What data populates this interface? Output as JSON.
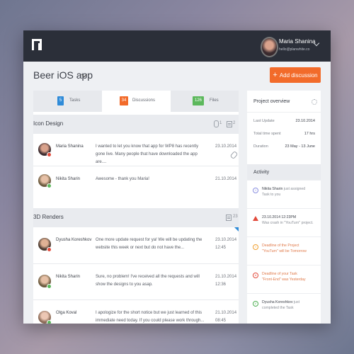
{
  "header": {
    "user_name": "Maria Shanina",
    "user_email": "hello@planwhite.co"
  },
  "project": {
    "title": "Beer iOS app",
    "add_button": "Add discussion",
    "add_icon": "+"
  },
  "tabs": [
    {
      "label": "Tasks",
      "count": "5",
      "color": "#2f8bd8"
    },
    {
      "label": "Discussions",
      "count": "34",
      "color": "#f26b2a"
    },
    {
      "label": "Files",
      "count": "126",
      "color": "#5cb85c"
    }
  ],
  "sections": [
    {
      "title": "Icon Design",
      "attachments": "1",
      "comments": "2",
      "rows": [
        {
          "name": "Maria Shanina",
          "message": "I wanted to let you know that app for WP8 has recently gone live. Many people that have downloaded the app are....",
          "date": "23.10.2014"
        },
        {
          "name": "Nikita Sharin",
          "message": "Awesome - thank you Maria!",
          "date": "21.10.2014"
        }
      ]
    },
    {
      "title": "3D Renders",
      "comments": "23",
      "rows": [
        {
          "name": "Dyusha Koreshkov",
          "message": "One more update request for ya! We will be updating the website this week or next but do not have the...",
          "date": "23.10.2014",
          "time": "12:45"
        },
        {
          "name": "Nikita Sharin",
          "message": "Sure, no problem! I've received all the requests and will show the designs to you asap.",
          "date": "21.10.2014",
          "time": "12:36"
        },
        {
          "name": "Olga Koval",
          "message": "I apologize for the short notice but we just learned of this immediate need today. If you could please work through...",
          "date": "21.10.2014",
          "time": "08:45"
        }
      ]
    }
  ],
  "overview": {
    "title": "Project overview",
    "last_update_label": "Last Update",
    "last_update_value": "23.10.2014",
    "time_spent_label": "Total time spent",
    "time_spent_value": "17 hrs",
    "duration_label": "Duration",
    "duration_value": "23 May - 13 June"
  },
  "activity": {
    "title": "Activity",
    "items": [
      {
        "actor": "Nikita Sharin",
        "action": "just assigned",
        "detail": "Task to you",
        "icon": "info-icon",
        "color": "#8a8fe0"
      },
      {
        "actor": "23.10.2014 12:23PM",
        "action": "",
        "detail": "Was crash in \"YouTurn\" project.",
        "icon": "warning-icon",
        "color": "#e24a3b"
      },
      {
        "actor": "",
        "action": "Deadline of the Project",
        "detail": "\"YouTurn\" will be Tomorrow",
        "icon": "clock-icon",
        "color": "#f0a030"
      },
      {
        "actor": "",
        "action": "Deadline of your Task",
        "detail": "\"Front-End\" was Yesterday",
        "icon": "alert-icon",
        "color": "#e24a3b"
      },
      {
        "actor": "Dyusha Koreshkov",
        "action": "just",
        "detail": "completed the Task",
        "icon": "check-icon",
        "color": "#4caf50"
      }
    ]
  }
}
